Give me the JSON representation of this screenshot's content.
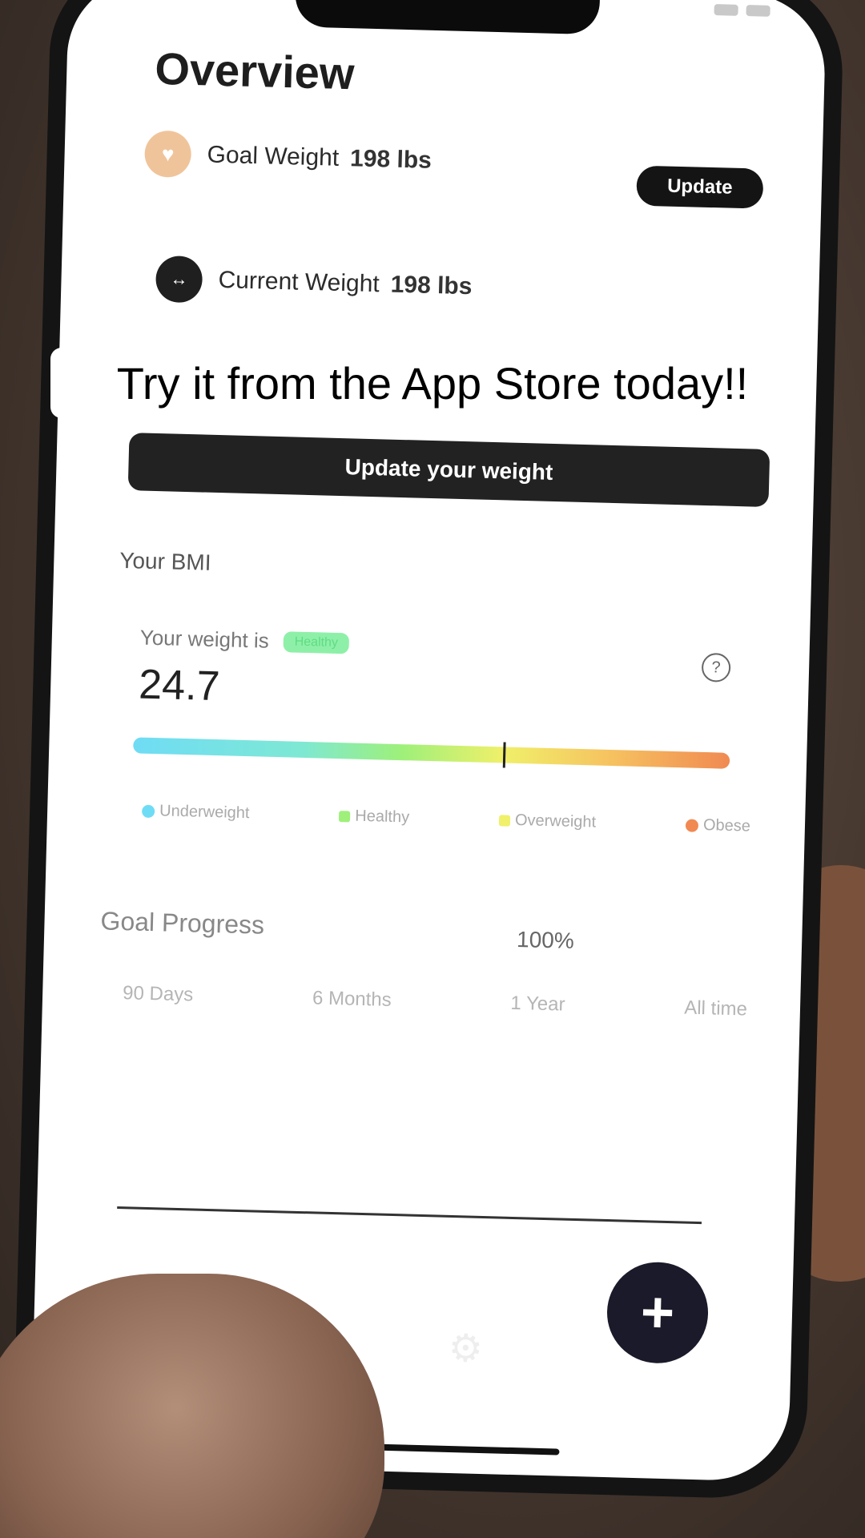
{
  "overview": {
    "title": "Overview",
    "goal_weight": {
      "label": "Goal Weight",
      "value": "198 lbs",
      "icon": "heart-icon"
    },
    "update_button": "Update",
    "current_weight": {
      "label": "Current Weight",
      "value": "198 lbs",
      "icon": "arrows-icon"
    },
    "update_weight_button": "Update your weight"
  },
  "bmi": {
    "section_label": "Your BMI",
    "weight_is_label": "Your weight is",
    "status_badge": "Healthy",
    "value": "24.7",
    "marker_position_fraction": 0.62,
    "legend": [
      "Underweight",
      "Healthy",
      "Overweight",
      "Obese"
    ],
    "legend_colors": [
      "#6fdcf5",
      "#9ef07a",
      "#f0f06a",
      "#f08a52"
    ]
  },
  "goal_progress": {
    "label": "Goal Progress",
    "percent": "100%",
    "ranges": [
      "90 Days",
      "6 Months",
      "1 Year",
      "All time"
    ]
  },
  "fab": {
    "label": "+"
  },
  "caption": "Try it from the App Store today!!"
}
